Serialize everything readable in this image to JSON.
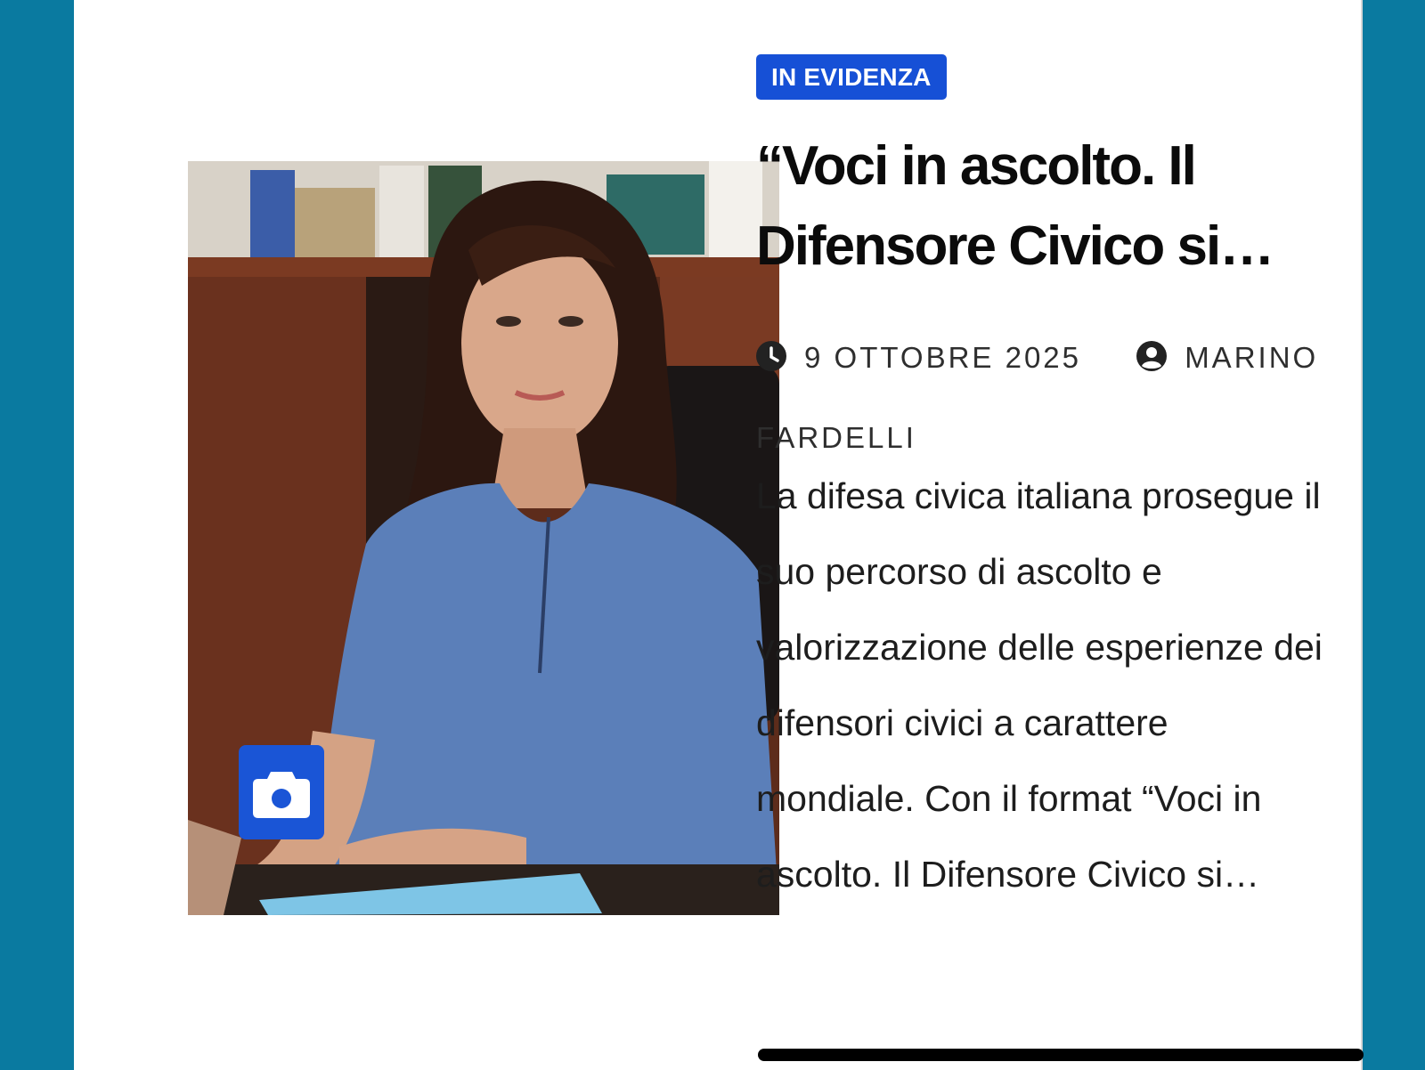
{
  "article": {
    "category": "IN EVIDENZA",
    "title": "“Voci in ascolto. Il Difensore Civico si…",
    "date": "9 OTTOBRE 2025",
    "author": "MARINO FARDELLI",
    "excerpt": "La difesa civica italiana prosegue il suo percorso di ascolto e valorizzazione delle esperienze dei difensori civici a carattere mondiale. Con il format “Voci in ascolto. Il Difensore Civico si…"
  },
  "icons": {
    "date": "clock-icon",
    "author": "user-circle-icon",
    "gallery": "camera-icon"
  },
  "colors": {
    "background": "#0a7aa0",
    "badge": "#1650d6",
    "camera_button": "#1a55d6",
    "title": "#0b0b0b"
  }
}
